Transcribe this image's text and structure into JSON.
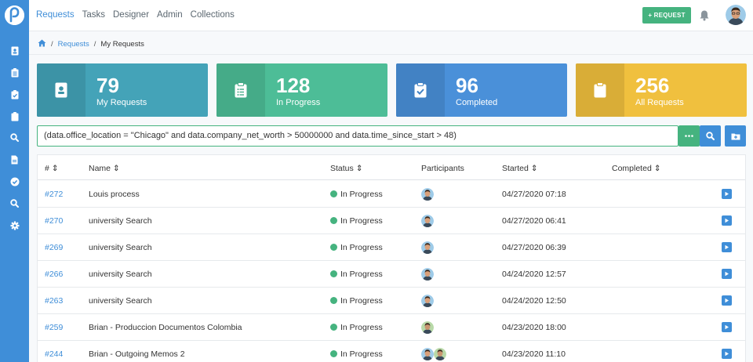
{
  "nav": {
    "items": [
      "Requests",
      "Tasks",
      "Designer",
      "Admin",
      "Collections"
    ],
    "active": "Requests"
  },
  "header": {
    "new_request_label": "+ REQUEST",
    "icons": [
      "bell-icon",
      "user-avatar"
    ]
  },
  "breadcrumb": {
    "home_icon": "home-icon",
    "separator": "/",
    "parent": "Requests",
    "current": "My Requests"
  },
  "stats": [
    {
      "value": "79",
      "label": "My Requests",
      "color": "#44a3b8",
      "icon": "id-badge-icon"
    },
    {
      "value": "128",
      "label": "In Progress",
      "color": "#4dbd97",
      "icon": "clipboard-list-icon"
    },
    {
      "value": "96",
      "label": "Completed",
      "color": "#4a90d9",
      "icon": "clipboard-check-icon"
    },
    {
      "value": "256",
      "label": "All Requests",
      "color": "#f0c03e",
      "icon": "clipboard-icon"
    }
  ],
  "search": {
    "value": "(data.office_location = \"Chicago\" and data.company_net_worth > 50000000 and data.time_since_start > 48)",
    "buttons": [
      "more-icon",
      "search-icon",
      "save-folder-icon"
    ]
  },
  "table": {
    "columns": [
      "#",
      "Name",
      "Status",
      "Participants",
      "Started",
      "Completed"
    ],
    "sortable": [
      true,
      true,
      true,
      false,
      true,
      true
    ],
    "rows": [
      {
        "id": "#272",
        "name": "Louis process",
        "status": "In Progress",
        "participants": 1,
        "started": "04/27/2020 07:18",
        "completed": ""
      },
      {
        "id": "#270",
        "name": "university Search",
        "status": "In Progress",
        "participants": 1,
        "started": "04/27/2020 06:41",
        "completed": ""
      },
      {
        "id": "#269",
        "name": "university Search",
        "status": "In Progress",
        "participants": 1,
        "started": "04/27/2020 06:39",
        "completed": ""
      },
      {
        "id": "#266",
        "name": "university Search",
        "status": "In Progress",
        "participants": 1,
        "started": "04/24/2020 12:57",
        "completed": ""
      },
      {
        "id": "#263",
        "name": "university Search",
        "status": "In Progress",
        "participants": 1,
        "started": "04/24/2020 12:50",
        "completed": ""
      },
      {
        "id": "#259",
        "name": "Brian - Produccion Documentos Colombia",
        "status": "In Progress",
        "participants": 1,
        "started": "04/23/2020 18:00",
        "completed": ""
      },
      {
        "id": "#244",
        "name": "Brian - Outgoing Memos 2",
        "status": "In Progress",
        "participants": 2,
        "started": "04/23/2020 11:10",
        "completed": ""
      }
    ]
  },
  "colors": {
    "primary": "#3f8ed8",
    "success": "#45b37f",
    "sidebar": "#3f8ed8"
  },
  "sidebar_icons": [
    "id-badge-icon",
    "clipboard-list-icon",
    "clipboard-check-icon",
    "clipboard-icon",
    "search-icon",
    "file-icon",
    "check-circle-icon",
    "search-icon",
    "gear-icon"
  ]
}
